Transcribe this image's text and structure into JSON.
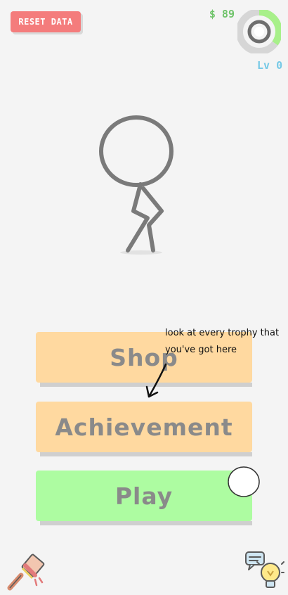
{
  "header": {
    "reset_label": "RESET DATA",
    "money": "$ 89",
    "level": "Lv 0",
    "level_progress": 0.35
  },
  "menu": {
    "shop_label": "Shop",
    "achievement_label": "Achievement",
    "play_label": "Play"
  },
  "hint": {
    "text": "look at every trophy that you've got here"
  },
  "colors": {
    "reset_button": "#f47c7c",
    "money_text": "#6fc36a",
    "level_text": "#75c9e6",
    "ring_progress": "#a8f08a",
    "ring_track": "#d6d6d6",
    "ring_center": "#6e6e6e",
    "shop_button": "#ffd9a0",
    "achievement_button": "#ffd9a0",
    "play_button": "#adfca1",
    "button_text": "#8a8a8a",
    "figure_stroke": "#7a7a7a"
  },
  "icons": {
    "bottom_left": "paint-brush-icon",
    "bottom_right": "lightbulb-icon",
    "top_right": "level-ring-icon"
  }
}
